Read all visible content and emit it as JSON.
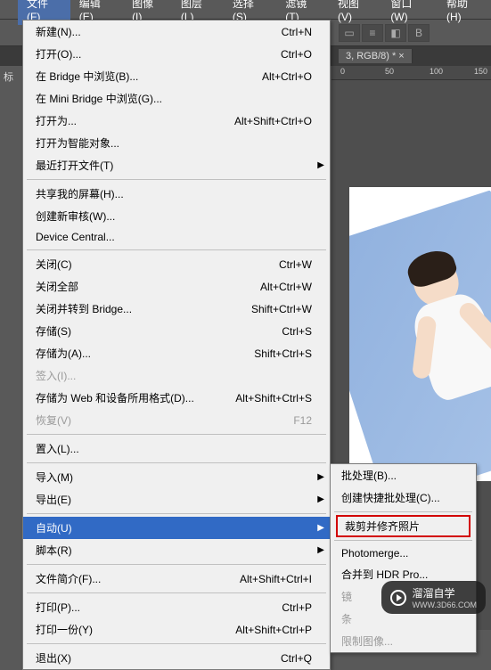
{
  "menubar": {
    "items": [
      {
        "label": "文件(F)",
        "open": true
      },
      {
        "label": "编辑(E)"
      },
      {
        "label": "图像(I)"
      },
      {
        "label": "图层(L)"
      },
      {
        "label": "选择(S)"
      },
      {
        "label": "滤镜(T)"
      },
      {
        "label": "视图(V)"
      },
      {
        "label": "窗口(W)"
      },
      {
        "label": "帮助(H)"
      }
    ]
  },
  "tab": {
    "title": "3, RGB/8) * ×"
  },
  "ruler": {
    "ticks": [
      "0",
      "50",
      "100",
      "150"
    ]
  },
  "left_label": "标",
  "file_menu": {
    "groups": [
      [
        {
          "label": "新建(N)...",
          "shortcut": "Ctrl+N"
        },
        {
          "label": "打开(O)...",
          "shortcut": "Ctrl+O"
        },
        {
          "label": "在 Bridge 中浏览(B)...",
          "shortcut": "Alt+Ctrl+O"
        },
        {
          "label": "在 Mini Bridge 中浏览(G)..."
        },
        {
          "label": "打开为...",
          "shortcut": "Alt+Shift+Ctrl+O"
        },
        {
          "label": "打开为智能对象..."
        },
        {
          "label": "最近打开文件(T)",
          "arrow": true
        }
      ],
      [
        {
          "label": "共享我的屏幕(H)..."
        },
        {
          "label": "创建新审核(W)..."
        },
        {
          "label": "Device Central..."
        }
      ],
      [
        {
          "label": "关闭(C)",
          "shortcut": "Ctrl+W"
        },
        {
          "label": "关闭全部",
          "shortcut": "Alt+Ctrl+W"
        },
        {
          "label": "关闭并转到 Bridge...",
          "shortcut": "Shift+Ctrl+W"
        },
        {
          "label": "存储(S)",
          "shortcut": "Ctrl+S"
        },
        {
          "label": "存储为(A)...",
          "shortcut": "Shift+Ctrl+S"
        },
        {
          "label": "签入(I)...",
          "disabled": true
        },
        {
          "label": "存储为 Web 和设备所用格式(D)...",
          "shortcut": "Alt+Shift+Ctrl+S"
        },
        {
          "label": "恢复(V)",
          "shortcut": "F12",
          "disabled": true
        }
      ],
      [
        {
          "label": "置入(L)..."
        }
      ],
      [
        {
          "label": "导入(M)",
          "arrow": true
        },
        {
          "label": "导出(E)",
          "arrow": true
        }
      ],
      [
        {
          "label": "自动(U)",
          "arrow": true,
          "highlighted": true
        },
        {
          "label": "脚本(R)",
          "arrow": true
        }
      ],
      [
        {
          "label": "文件简介(F)...",
          "shortcut": "Alt+Shift+Ctrl+I"
        }
      ],
      [
        {
          "label": "打印(P)...",
          "shortcut": "Ctrl+P"
        },
        {
          "label": "打印一份(Y)",
          "shortcut": "Alt+Shift+Ctrl+P"
        }
      ],
      [
        {
          "label": "退出(X)",
          "shortcut": "Ctrl+Q"
        }
      ]
    ]
  },
  "auto_submenu": {
    "groups": [
      [
        {
          "label": "批处理(B)..."
        },
        {
          "label": "创建快捷批处理(C)..."
        }
      ],
      [
        {
          "label": "裁剪并修齐照片",
          "boxed": true
        }
      ],
      [
        {
          "label": "Photomerge..."
        },
        {
          "label": "合并到 HDR Pro..."
        },
        {
          "label": "镜",
          "disabled": true
        },
        {
          "label": "条",
          "disabled": true
        },
        {
          "label": "限制图像...",
          "disabled": true
        }
      ]
    ]
  },
  "watermark": {
    "brand": "溜溜自学",
    "site": "WWW.3D66.COM"
  }
}
